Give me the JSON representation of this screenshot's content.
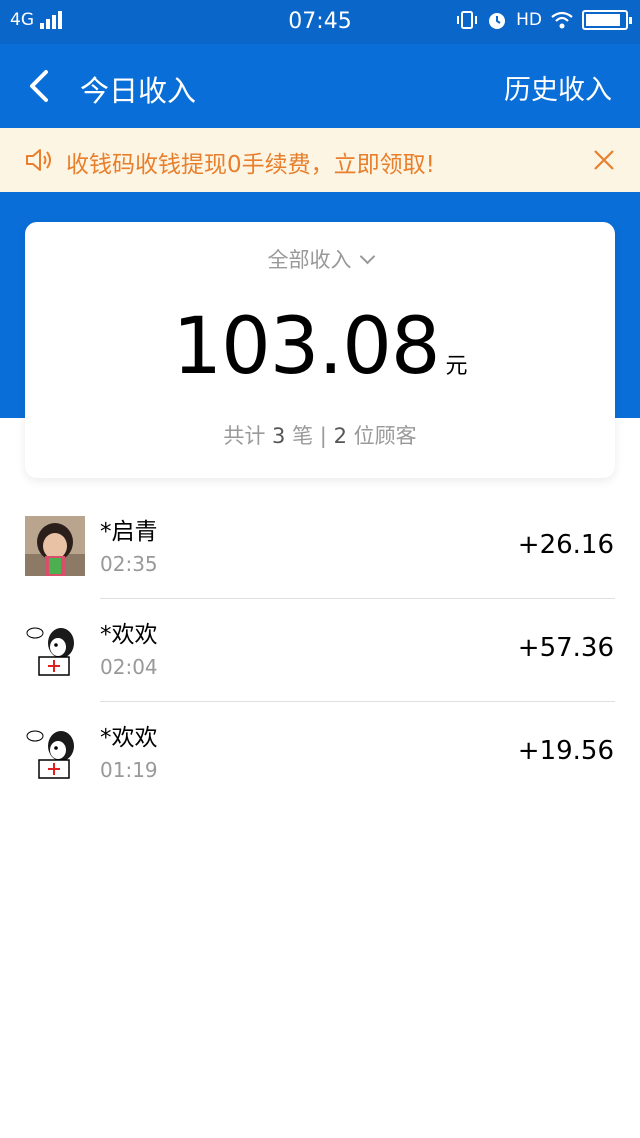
{
  "status_bar": {
    "network": "4G",
    "time": "07:45",
    "hd": "HD",
    "icons": [
      "signal-icon",
      "vibrate-icon",
      "alarm-icon",
      "wifi-icon",
      "battery-icon"
    ],
    "battery_level": 0.9
  },
  "nav": {
    "title": "今日收入",
    "history_label": "历史收入",
    "back_icon": "chevron-left-icon"
  },
  "notice": {
    "text": "收钱码收钱提现0手续费，立即领取!",
    "icon": "speaker-icon",
    "close_icon": "close-icon"
  },
  "summary": {
    "filter_label": "全部收入",
    "amount": "103.08",
    "unit": "元",
    "stats": {
      "prefix": "共计",
      "count": "3",
      "count_unit": "笔",
      "separator": "|",
      "customers": "2",
      "customers_unit": "位顾客"
    }
  },
  "transactions": [
    {
      "name": "*启青",
      "time": "02:35",
      "amount": "+26.16",
      "avatar": "photo-avatar"
    },
    {
      "name": "*欢欢",
      "time": "02:04",
      "amount": "+57.36",
      "avatar": "cartoon-dog-avatar"
    },
    {
      "name": "*欢欢",
      "time": "01:19",
      "amount": "+19.56",
      "avatar": "cartoon-dog-avatar"
    }
  ],
  "colors": {
    "brand_blue": "#0a6ed8",
    "notice_bg": "#fdf5e3",
    "notice_text": "#e87f2c"
  }
}
